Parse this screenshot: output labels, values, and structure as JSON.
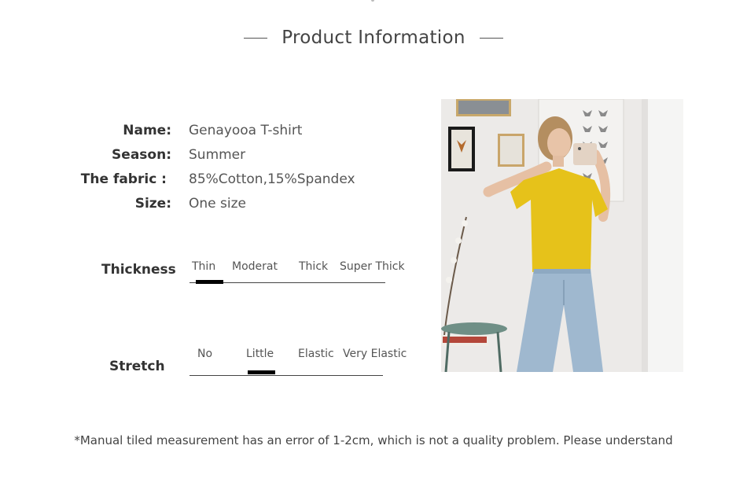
{
  "header": {
    "title": "Product Information"
  },
  "specs": {
    "name_label": "Name:",
    "name_value": "Genayooa T-shirt",
    "season_label": "Season:",
    "season_value": "Summer",
    "fabric_label": "The fabric :",
    "fabric_value": "85%Cotton,15%Spandex",
    "size_label": "Size:",
    "size_value": "One size"
  },
  "thickness": {
    "label": "Thickness",
    "options": [
      "Thin",
      "Moderat",
      "Thick",
      "Super Thick"
    ],
    "selected": "Thin"
  },
  "stretch": {
    "label": "Stretch",
    "options": [
      "No",
      "Little",
      "Elastic",
      "Very Elastic"
    ],
    "selected": "Little"
  },
  "footnote": "*Manual tiled measurement has an error of 1-2cm, which is not a quality problem. Please understand",
  "colors": {
    "shirt": "#e6c21a",
    "jeans": "#9fb8cf",
    "wall": "#ecebea",
    "marker": "#000000"
  }
}
